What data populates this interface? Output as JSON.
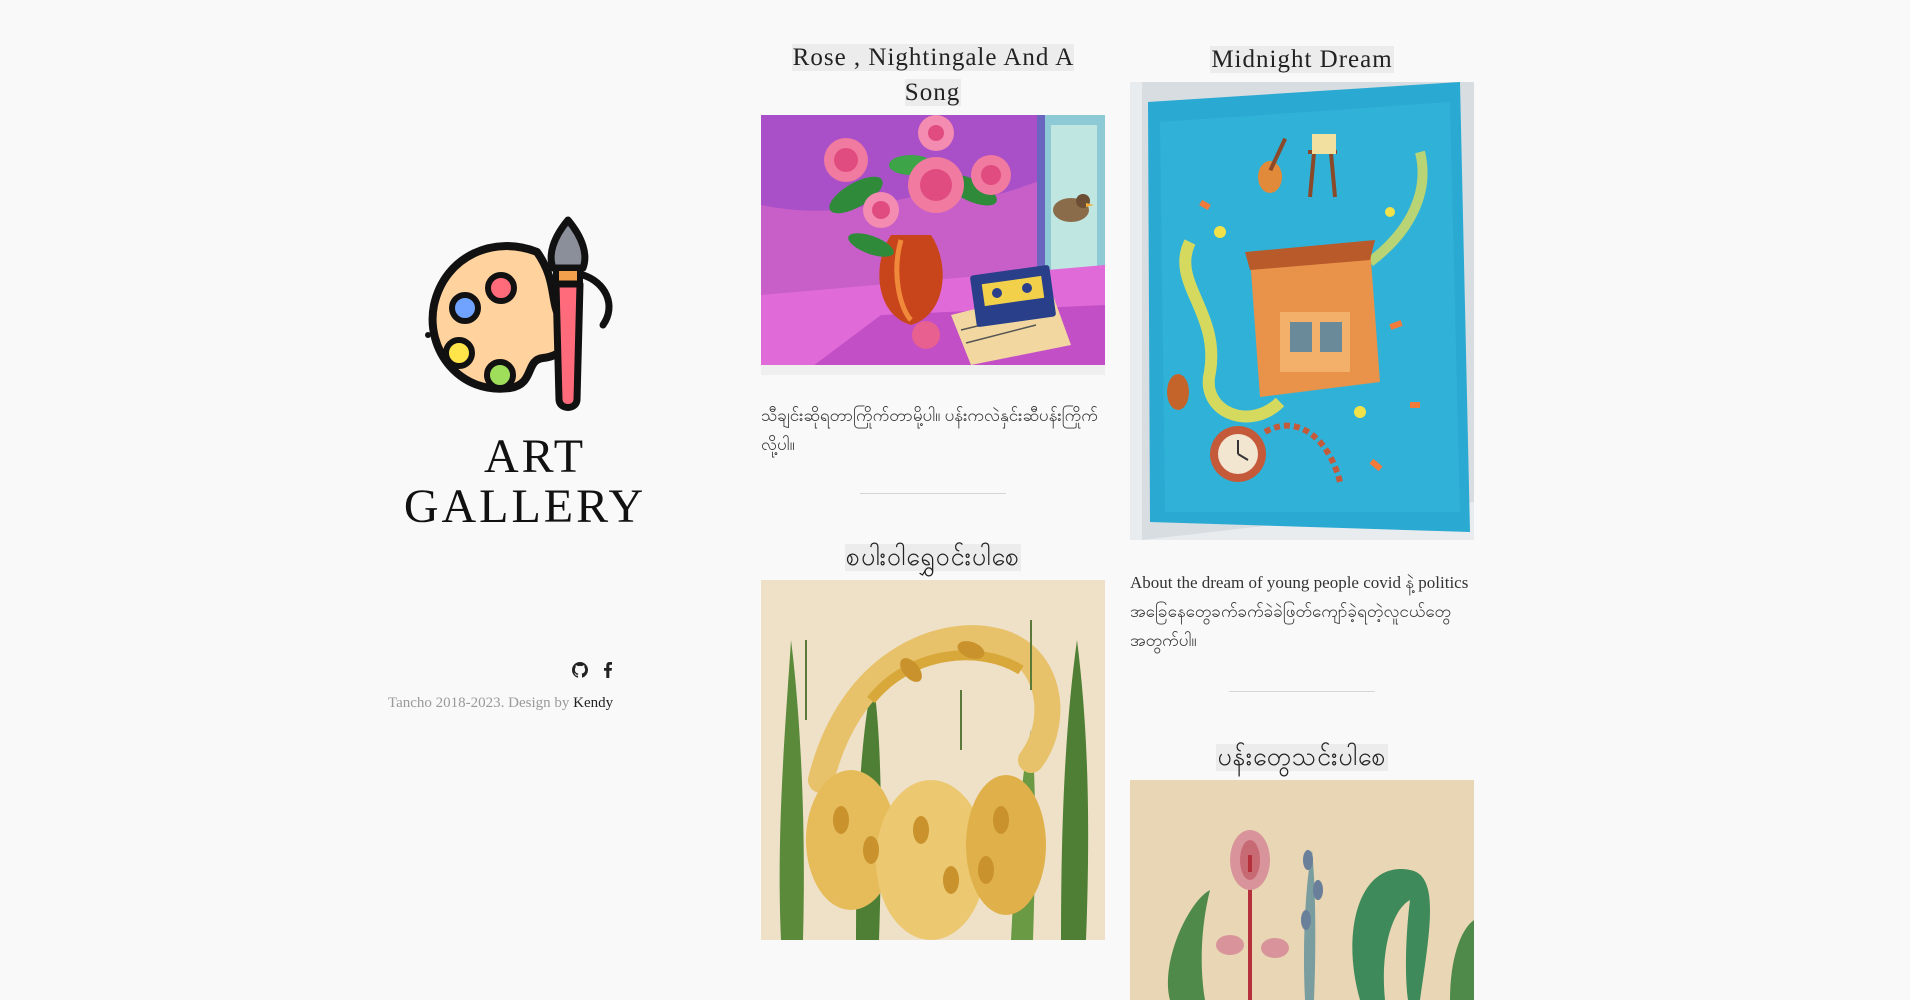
{
  "brand": {
    "line1": "ART",
    "line2": "GALLERY"
  },
  "socials": [
    {
      "icon": "github-icon"
    },
    {
      "icon": "facebook-icon"
    }
  ],
  "footer": {
    "copyright": "Tancho 2018-2023. Design by ",
    "author": "Kendy"
  },
  "gallery": {
    "left": [
      {
        "title": "Rose , Nightingale And A Song",
        "description": "သီချင်းဆိုရတာကြိုက်တာမို့ပါ။ ပန်းကလဲနှင်းဆီပန်းကြိုက်လို့ပါ။"
      },
      {
        "title": "စပါးဝါရွှေဝင်းပါစေ"
      }
    ],
    "right": [
      {
        "title": "Midnight Dream",
        "description": "About the dream of young people covid နဲ့ politics အခြေနေတွေခက်ခက်ခဲခဲဖြတ်ကျော်ခဲ့ရတဲ့လူငယ်တွေအတွက်ပါ။"
      },
      {
        "title": "ပန်းတွေသင်းပါစေ"
      }
    ]
  },
  "colors": {
    "background": "#f9f9f9",
    "title_highlight": "#ececec",
    "footer_muted": "#9a9a9a"
  }
}
